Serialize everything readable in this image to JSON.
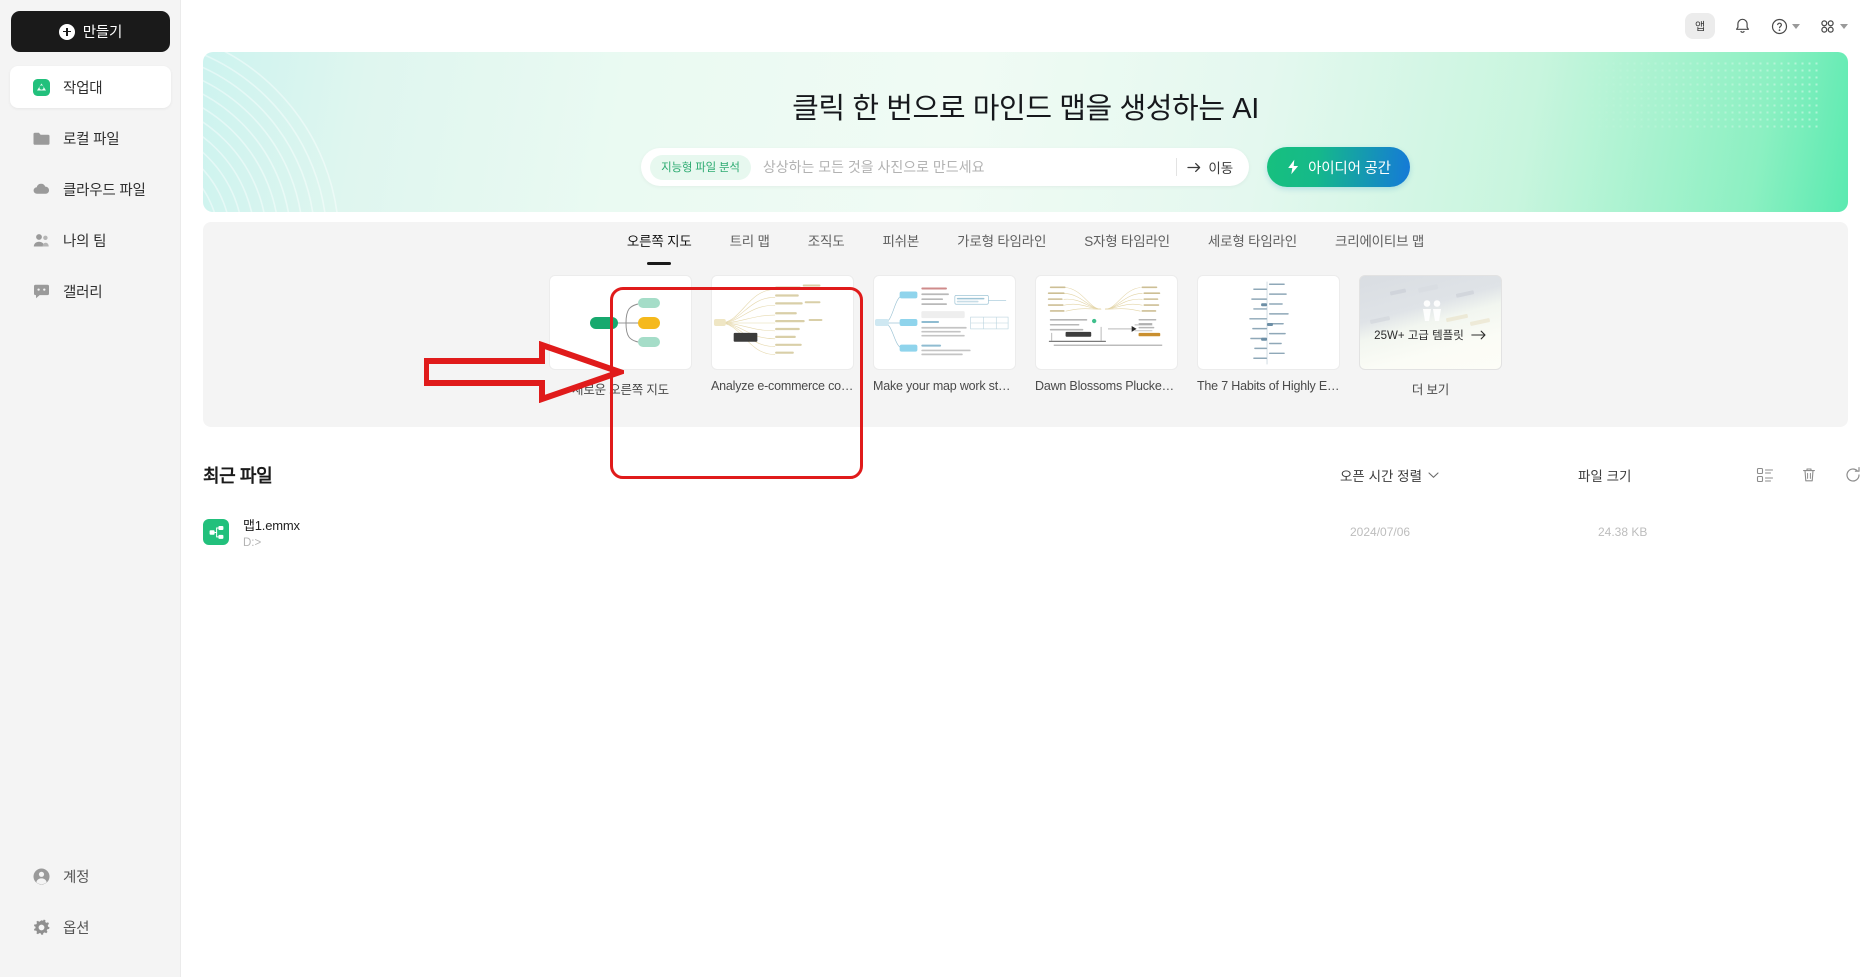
{
  "app": {
    "sidebar": {
      "create_button": "만들기",
      "items": [
        {
          "label": "작업대",
          "icon": "workbench-icon",
          "active": true
        },
        {
          "label": "로컬 파일",
          "icon": "folder-icon",
          "active": false
        },
        {
          "label": "클라우드 파일",
          "icon": "cloud-icon",
          "active": false
        },
        {
          "label": "나의 팀",
          "icon": "team-icon",
          "active": false
        },
        {
          "label": "갤러리",
          "icon": "gallery-icon",
          "active": false
        }
      ],
      "bottom_items": [
        {
          "label": "계정",
          "icon": "account-icon"
        },
        {
          "label": "옵션",
          "icon": "gear-icon"
        }
      ]
    },
    "topbar": {
      "app_label": "앱",
      "icons": [
        "app-badge-icon",
        "bell-icon",
        "help-icon",
        "grid-apps-icon"
      ]
    },
    "banner": {
      "title": "클릭 한 번으로 마인드 맵을 생성하는 AI",
      "ai_badge": "지능형 파일 분석",
      "search_placeholder": "상상하는 모든 것을 사진으로 만드세요",
      "search_value": "",
      "go_label": "이동",
      "idea_button": "아이디어 공간",
      "gradient_start": "#cdf3ef",
      "gradient_end": "#5aeab0"
    },
    "templates": {
      "tabs": [
        {
          "label": "오른쪽 지도",
          "active": true
        },
        {
          "label": "트리 맵",
          "active": false
        },
        {
          "label": "조직도",
          "active": false
        },
        {
          "label": "피쉬본",
          "active": false
        },
        {
          "label": "가로형 타임라인",
          "active": false
        },
        {
          "label": "S자형 타임라인",
          "active": false
        },
        {
          "label": "세로형 타임라인",
          "active": false
        },
        {
          "label": "크리에이티브 맵",
          "active": false
        }
      ],
      "cards": [
        {
          "caption": "새로운 오른쪽 지도",
          "kind": "new-right-map"
        },
        {
          "caption": "Analyze e-commerce cop...",
          "kind": "thumb-radial"
        },
        {
          "caption": "Make your map work stan...",
          "kind": "thumb-tree"
        },
        {
          "caption": "Dawn Blossoms Plucked a...",
          "kind": "thumb-butterfly"
        },
        {
          "caption": "The 7 Habits of Highly Eff...",
          "kind": "thumb-vertical"
        },
        {
          "caption": "더 보기",
          "kind": "more",
          "overlay": "25W+ 고급 템플릿"
        }
      ]
    },
    "recent": {
      "title": "최근 파일",
      "sort_label": "오픈 시간 정렬",
      "size_header": "파일 크기",
      "tool_icons": [
        "list-view-icon",
        "trash-icon",
        "refresh-icon"
      ],
      "files": [
        {
          "name": "맵1.emmx",
          "path": "D:>",
          "date": "2024/07/06",
          "size": "24.38 KB",
          "icon": "mindmap-file-icon"
        }
      ]
    },
    "annotation": {
      "color": "#e01b1b",
      "arrow": "right-arrow-annotation",
      "box": "highlight-box-annotation"
    }
  }
}
